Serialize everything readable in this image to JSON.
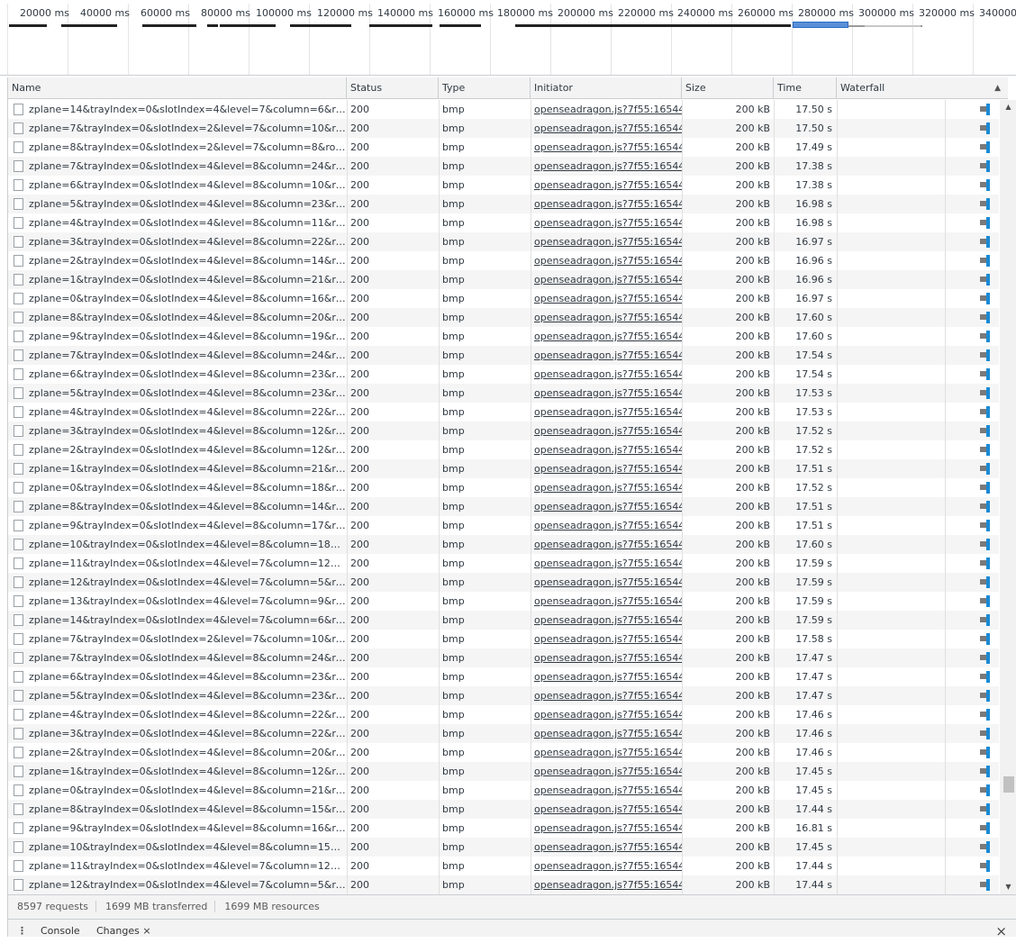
{
  "overview": {
    "ticks": [
      "20000 ms",
      "40000 ms",
      "60000 ms",
      "80000 ms",
      "100000 ms",
      "120000 ms",
      "140000 ms",
      "160000 ms",
      "180000 ms",
      "200000 ms",
      "220000 ms",
      "240000 ms",
      "260000 ms",
      "280000 ms",
      "300000 ms",
      "320000 ms",
      "340000"
    ]
  },
  "columns": {
    "name": "Name",
    "status": "Status",
    "type": "Type",
    "initiator": "Initiator",
    "size": "Size",
    "time": "Time",
    "waterfall": "Waterfall"
  },
  "sort_arrow": "▲",
  "rows": [
    {
      "name": "zplane=14&trayIndex=0&slotIndex=4&level=7&column=6&ro…",
      "status": "200",
      "type": "bmp",
      "initiator": "openseadragon.js?7f55:16544",
      "size": "200 kB",
      "time": "17.50 s"
    },
    {
      "name": "zplane=7&trayIndex=0&slotIndex=2&level=7&column=10&ro…",
      "status": "200",
      "type": "bmp",
      "initiator": "openseadragon.js?7f55:16544",
      "size": "200 kB",
      "time": "17.50 s"
    },
    {
      "name": "zplane=8&trayIndex=0&slotIndex=2&level=7&column=8&ro…",
      "status": "200",
      "type": "bmp",
      "initiator": "openseadragon.js?7f55:16544",
      "size": "200 kB",
      "time": "17.49 s"
    },
    {
      "name": "zplane=7&trayIndex=0&slotIndex=4&level=8&column=24&ro…",
      "status": "200",
      "type": "bmp",
      "initiator": "openseadragon.js?7f55:16544",
      "size": "200 kB",
      "time": "17.38 s"
    },
    {
      "name": "zplane=6&trayIndex=0&slotIndex=4&level=8&column=10&ro…",
      "status": "200",
      "type": "bmp",
      "initiator": "openseadragon.js?7f55:16544",
      "size": "200 kB",
      "time": "17.38 s"
    },
    {
      "name": "zplane=5&trayIndex=0&slotIndex=4&level=8&column=23&ro…",
      "status": "200",
      "type": "bmp",
      "initiator": "openseadragon.js?7f55:16544",
      "size": "200 kB",
      "time": "16.98 s"
    },
    {
      "name": "zplane=4&trayIndex=0&slotIndex=4&level=8&column=11&ro…",
      "status": "200",
      "type": "bmp",
      "initiator": "openseadragon.js?7f55:16544",
      "size": "200 kB",
      "time": "16.98 s"
    },
    {
      "name": "zplane=3&trayIndex=0&slotIndex=4&level=8&column=22&ro…",
      "status": "200",
      "type": "bmp",
      "initiator": "openseadragon.js?7f55:16544",
      "size": "200 kB",
      "time": "16.97 s"
    },
    {
      "name": "zplane=2&trayIndex=0&slotIndex=4&level=8&column=14&ro…",
      "status": "200",
      "type": "bmp",
      "initiator": "openseadragon.js?7f55:16544",
      "size": "200 kB",
      "time": "16.96 s"
    },
    {
      "name": "zplane=1&trayIndex=0&slotIndex=4&level=8&column=21&ro…",
      "status": "200",
      "type": "bmp",
      "initiator": "openseadragon.js?7f55:16544",
      "size": "200 kB",
      "time": "16.96 s"
    },
    {
      "name": "zplane=0&trayIndex=0&slotIndex=4&level=8&column=16&ro…",
      "status": "200",
      "type": "bmp",
      "initiator": "openseadragon.js?7f55:16544",
      "size": "200 kB",
      "time": "16.97 s"
    },
    {
      "name": "zplane=8&trayIndex=0&slotIndex=4&level=8&column=20&ro…",
      "status": "200",
      "type": "bmp",
      "initiator": "openseadragon.js?7f55:16544",
      "size": "200 kB",
      "time": "17.60 s"
    },
    {
      "name": "zplane=9&trayIndex=0&slotIndex=4&level=8&column=19&ro…",
      "status": "200",
      "type": "bmp",
      "initiator": "openseadragon.js?7f55:16544",
      "size": "200 kB",
      "time": "17.60 s"
    },
    {
      "name": "zplane=7&trayIndex=0&slotIndex=4&level=8&column=24&ro…",
      "status": "200",
      "type": "bmp",
      "initiator": "openseadragon.js?7f55:16544",
      "size": "200 kB",
      "time": "17.54 s"
    },
    {
      "name": "zplane=6&trayIndex=0&slotIndex=4&level=8&column=23&ro…",
      "status": "200",
      "type": "bmp",
      "initiator": "openseadragon.js?7f55:16544",
      "size": "200 kB",
      "time": "17.54 s"
    },
    {
      "name": "zplane=5&trayIndex=0&slotIndex=4&level=8&column=23&ro…",
      "status": "200",
      "type": "bmp",
      "initiator": "openseadragon.js?7f55:16544",
      "size": "200 kB",
      "time": "17.53 s"
    },
    {
      "name": "zplane=4&trayIndex=0&slotIndex=4&level=8&column=22&ro…",
      "status": "200",
      "type": "bmp",
      "initiator": "openseadragon.js?7f55:16544",
      "size": "200 kB",
      "time": "17.53 s"
    },
    {
      "name": "zplane=3&trayIndex=0&slotIndex=4&level=8&column=12&ro…",
      "status": "200",
      "type": "bmp",
      "initiator": "openseadragon.js?7f55:16544",
      "size": "200 kB",
      "time": "17.52 s"
    },
    {
      "name": "zplane=2&trayIndex=0&slotIndex=4&level=8&column=12&ro…",
      "status": "200",
      "type": "bmp",
      "initiator": "openseadragon.js?7f55:16544",
      "size": "200 kB",
      "time": "17.52 s"
    },
    {
      "name": "zplane=1&trayIndex=0&slotIndex=4&level=8&column=21&ro…",
      "status": "200",
      "type": "bmp",
      "initiator": "openseadragon.js?7f55:16544",
      "size": "200 kB",
      "time": "17.51 s"
    },
    {
      "name": "zplane=0&trayIndex=0&slotIndex=4&level=8&column=18&ro…",
      "status": "200",
      "type": "bmp",
      "initiator": "openseadragon.js?7f55:16544",
      "size": "200 kB",
      "time": "17.52 s"
    },
    {
      "name": "zplane=8&trayIndex=0&slotIndex=4&level=8&column=14&ro…",
      "status": "200",
      "type": "bmp",
      "initiator": "openseadragon.js?7f55:16544",
      "size": "200 kB",
      "time": "17.51 s"
    },
    {
      "name": "zplane=9&trayIndex=0&slotIndex=4&level=8&column=17&ro…",
      "status": "200",
      "type": "bmp",
      "initiator": "openseadragon.js?7f55:16544",
      "size": "200 kB",
      "time": "17.51 s"
    },
    {
      "name": "zplane=10&trayIndex=0&slotIndex=4&level=8&column=18&r…",
      "status": "200",
      "type": "bmp",
      "initiator": "openseadragon.js?7f55:16544",
      "size": "200 kB",
      "time": "17.60 s"
    },
    {
      "name": "zplane=11&trayIndex=0&slotIndex=4&level=7&column=12&r…",
      "status": "200",
      "type": "bmp",
      "initiator": "openseadragon.js?7f55:16544",
      "size": "200 kB",
      "time": "17.59 s"
    },
    {
      "name": "zplane=12&trayIndex=0&slotIndex=4&level=7&column=5&ro…",
      "status": "200",
      "type": "bmp",
      "initiator": "openseadragon.js?7f55:16544",
      "size": "200 kB",
      "time": "17.59 s"
    },
    {
      "name": "zplane=13&trayIndex=0&slotIndex=4&level=7&column=9&ro…",
      "status": "200",
      "type": "bmp",
      "initiator": "openseadragon.js?7f55:16544",
      "size": "200 kB",
      "time": "17.59 s"
    },
    {
      "name": "zplane=14&trayIndex=0&slotIndex=4&level=7&column=6&ro…",
      "status": "200",
      "type": "bmp",
      "initiator": "openseadragon.js?7f55:16544",
      "size": "200 kB",
      "time": "17.59 s"
    },
    {
      "name": "zplane=7&trayIndex=0&slotIndex=2&level=7&column=10&ro…",
      "status": "200",
      "type": "bmp",
      "initiator": "openseadragon.js?7f55:16544",
      "size": "200 kB",
      "time": "17.58 s"
    },
    {
      "name": "zplane=7&trayIndex=0&slotIndex=4&level=8&column=24&ro…",
      "status": "200",
      "type": "bmp",
      "initiator": "openseadragon.js?7f55:16544",
      "size": "200 kB",
      "time": "17.47 s"
    },
    {
      "name": "zplane=6&trayIndex=0&slotIndex=4&level=8&column=23&ro…",
      "status": "200",
      "type": "bmp",
      "initiator": "openseadragon.js?7f55:16544",
      "size": "200 kB",
      "time": "17.47 s"
    },
    {
      "name": "zplane=5&trayIndex=0&slotIndex=4&level=8&column=23&ro…",
      "status": "200",
      "type": "bmp",
      "initiator": "openseadragon.js?7f55:16544",
      "size": "200 kB",
      "time": "17.47 s"
    },
    {
      "name": "zplane=4&trayIndex=0&slotIndex=4&level=8&column=22&ro…",
      "status": "200",
      "type": "bmp",
      "initiator": "openseadragon.js?7f55:16544",
      "size": "200 kB",
      "time": "17.46 s"
    },
    {
      "name": "zplane=3&trayIndex=0&slotIndex=4&level=8&column=22&ro…",
      "status": "200",
      "type": "bmp",
      "initiator": "openseadragon.js?7f55:16544",
      "size": "200 kB",
      "time": "17.46 s"
    },
    {
      "name": "zplane=2&trayIndex=0&slotIndex=4&level=8&column=20&ro…",
      "status": "200",
      "type": "bmp",
      "initiator": "openseadragon.js?7f55:16544",
      "size": "200 kB",
      "time": "17.46 s"
    },
    {
      "name": "zplane=1&trayIndex=0&slotIndex=4&level=8&column=12&ro…",
      "status": "200",
      "type": "bmp",
      "initiator": "openseadragon.js?7f55:16544",
      "size": "200 kB",
      "time": "17.45 s"
    },
    {
      "name": "zplane=0&trayIndex=0&slotIndex=4&level=8&column=21&ro…",
      "status": "200",
      "type": "bmp",
      "initiator": "openseadragon.js?7f55:16544",
      "size": "200 kB",
      "time": "17.45 s"
    },
    {
      "name": "zplane=8&trayIndex=0&slotIndex=4&level=8&column=15&ro…",
      "status": "200",
      "type": "bmp",
      "initiator": "openseadragon.js?7f55:16544",
      "size": "200 kB",
      "time": "17.44 s"
    },
    {
      "name": "zplane=9&trayIndex=0&slotIndex=4&level=8&column=16&ro…",
      "status": "200",
      "type": "bmp",
      "initiator": "openseadragon.js?7f55:16544",
      "size": "200 kB",
      "time": "16.81 s"
    },
    {
      "name": "zplane=10&trayIndex=0&slotIndex=4&level=8&column=15&r…",
      "status": "200",
      "type": "bmp",
      "initiator": "openseadragon.js?7f55:16544",
      "size": "200 kB",
      "time": "17.45 s"
    },
    {
      "name": "zplane=11&trayIndex=0&slotIndex=4&level=7&column=12&r…",
      "status": "200",
      "type": "bmp",
      "initiator": "openseadragon.js?7f55:16544",
      "size": "200 kB",
      "time": "17.44 s"
    },
    {
      "name": "zplane=12&trayIndex=0&slotIndex=4&level=7&column=5&ro…",
      "status": "200",
      "type": "bmp",
      "initiator": "openseadragon.js?7f55:16544",
      "size": "200 kB",
      "time": "17.44 s"
    }
  ],
  "statusbar": {
    "requests": "8597 requests",
    "transferred": "1699 MB transferred",
    "resources": "1699 MB resources"
  },
  "drawer": {
    "menu_icon": "⋮",
    "tabs": [
      "Console",
      "Changes ×"
    ],
    "close_icon": "×"
  }
}
